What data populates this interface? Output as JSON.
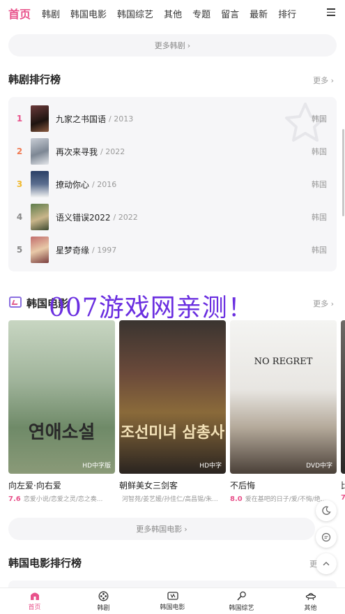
{
  "topnav": {
    "items": [
      "首页",
      "韩剧",
      "韩国电影",
      "韩国综艺",
      "其他",
      "专题",
      "留言",
      "最新",
      "排行"
    ]
  },
  "more_drama": "更多韩剧",
  "drama_rank": {
    "title": "韩剧排行榜",
    "more": "更多",
    "rows": [
      {
        "rank": "1",
        "name": "九家之书国语",
        "year": "/ 2013",
        "region": "韩国",
        "rank_color": "#e8528b"
      },
      {
        "rank": "2",
        "name": "再次来寻我",
        "year": "/ 2022",
        "region": "韩国",
        "rank_color": "#f07b54"
      },
      {
        "rank": "3",
        "name": "撩动你心",
        "year": "/ 2016",
        "region": "韩国",
        "rank_color": "#f0b92f"
      },
      {
        "rank": "4",
        "name": "语义错误2022",
        "year": "/ 2022",
        "region": "韩国",
        "rank_color": "#888888"
      },
      {
        "rank": "5",
        "name": "星梦奇缘",
        "year": "/ 1997",
        "region": "韩国",
        "rank_color": "#888888"
      }
    ]
  },
  "movies_section": {
    "title": "韩国电影",
    "more": "更多",
    "watermark": "007游戏网亲测！",
    "items": [
      {
        "title": "向左爱·向右爱",
        "score": "7.6",
        "cast": "恋爱小说/恋爱之灵/恋之奏...",
        "badge": "HD中字版",
        "poster_text": "연애소설"
      },
      {
        "title": "朝鲜美女三剑客",
        "score": "",
        "cast": "河智苑/姜艺媛/孙佳仁/高昌锡/朱...",
        "badge": "HD中字",
        "poster_text": "조선미녀 삼총사"
      },
      {
        "title": "不后悔",
        "score": "8.0",
        "cast": "爱在基吧的日子/爱/不悔/绝...",
        "badge": "DVD中字",
        "poster_text": "NO REGRET"
      },
      {
        "title": "比",
        "score": "7",
        "cast": "",
        "badge": "",
        "poster_text": ""
      }
    ]
  },
  "more_movies": "更多韩国电影",
  "movie_rank": {
    "title": "韩国电影排行榜",
    "more": "更"
  },
  "tabs": [
    {
      "label": "首页",
      "icon": "home-icon"
    },
    {
      "label": "韩剧",
      "icon": "film-reel-icon"
    },
    {
      "label": "韩国电影",
      "icon": "tv-icon"
    },
    {
      "label": "韩国综艺",
      "icon": "microphone-icon"
    },
    {
      "label": "其他",
      "icon": "ufo-icon"
    }
  ],
  "colors": {
    "accent": "#e8528b",
    "watermark": "#6a2ee0"
  }
}
